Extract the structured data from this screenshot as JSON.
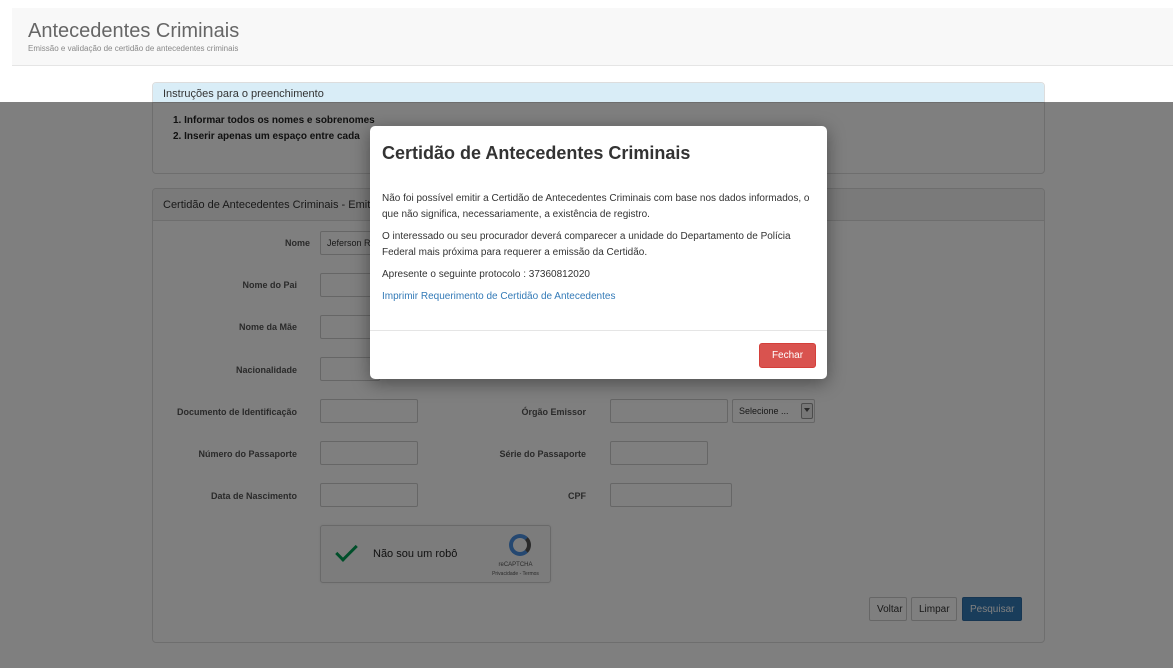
{
  "header": {
    "title": "Antecedentes Criminais",
    "subtitle": "Emissão e validação de certidão de antecedentes criminais"
  },
  "instructions": {
    "heading": "Instruções para o preenchimento",
    "items": [
      "1. Informar todos os nomes e sobrenomes",
      "2. Inserir apenas um espaço entre cada"
    ]
  },
  "form": {
    "heading": "Certidão de Antecedentes Criminais - Emiti",
    "nome_label": "Nome",
    "nome_value": "Jeferson R",
    "nome_pai_label": "Nome do Pai",
    "nome_mae_label": "Nome da Mãe",
    "nacionalidade_label": "Nacionalidade",
    "documento_label": "Documento de Identificação",
    "orgao_label": "Órgão Emissor",
    "orgao_select": "Selecione ...",
    "passaporte_label": "Número do Passaporte",
    "serie_label": "Série do Passaporte",
    "nascimento_label": "Data de Nascimento",
    "cpf_label": "CPF",
    "captcha_text": "Não sou um robô",
    "captcha_brand": "reCAPTCHA",
    "captcha_terms": "Privacidade - Termos",
    "voltar": "Voltar",
    "limpar": "Limpar",
    "pesquisar": "Pesquisar"
  },
  "modal": {
    "title": "Certidão de Antecedentes Criminais",
    "p1": "Não foi possível emitir a Certidão de Antecedentes Criminais com base nos dados informados, o que não significa, necessariamente, a existência de registro.",
    "p2": "O interessado ou seu procurador deverá comparecer a unidade do Departamento de Polícia Federal mais próxima para requerer a emissão da Certidão.",
    "p3": "Apresente o seguinte protocolo : 37360812020",
    "link": "Imprimir Requerimento de Certidão de Antecedentes",
    "close": "Fechar"
  }
}
